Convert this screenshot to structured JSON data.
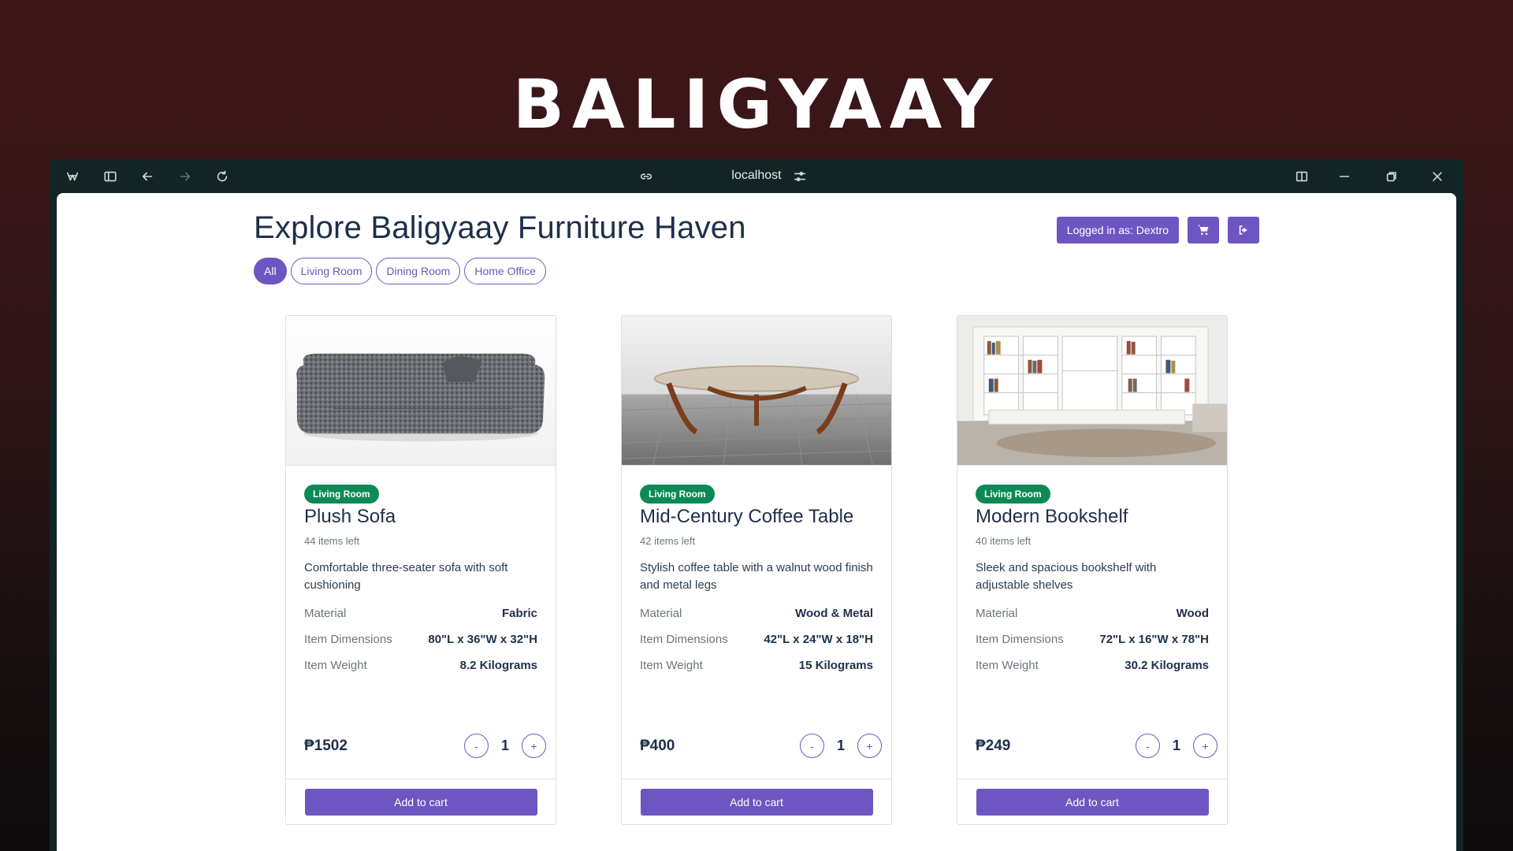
{
  "brand": "BALIGYAAY",
  "browser": {
    "url": "localhost",
    "icons": [
      "app-logo-icon",
      "sidebar-toggle-icon",
      "back-icon",
      "forward-icon",
      "reload-icon",
      "link-icon",
      "site-settings-icon",
      "split-view-icon",
      "minimize-icon",
      "restore-icon",
      "close-icon"
    ]
  },
  "page": {
    "title": "Explore Baligyaay Furniture Haven",
    "logged_in_label": "Logged in as: Dextro",
    "filters": [
      "All",
      "Living Room",
      "Dining Room",
      "Home Office"
    ],
    "active_filter": "All"
  },
  "labels": {
    "material": "Material",
    "dimensions": "Item Dimensions",
    "weight": "Item Weight",
    "minus": "-",
    "plus": "+",
    "add_to_cart": "Add to cart"
  },
  "products": [
    {
      "category": "Living Room",
      "name": "Plush Sofa",
      "stock": "44 items left",
      "description": "Comfortable three-seater sofa with soft cushioning",
      "material": "Fabric",
      "dimensions": "80\"L x 36\"W x 32\"H",
      "weight": "8.2 Kilograms",
      "price": "₱1502",
      "quantity": "1"
    },
    {
      "category": "Living Room",
      "name": "Mid-Century Coffee Table",
      "stock": "42 items left",
      "description": "Stylish coffee table with a walnut wood finish and metal legs",
      "material": "Wood & Metal",
      "dimensions": "42\"L x 24\"W x 18\"H",
      "weight": "15 Kilograms",
      "price": "₱400",
      "quantity": "1"
    },
    {
      "category": "Living Room",
      "name": "Modern Bookshelf",
      "stock": "40 items left",
      "description": "Sleek and spacious bookshelf with adjustable shelves",
      "material": "Wood",
      "dimensions": "72\"L x 16\"W x 78\"H",
      "weight": "30.2 Kilograms",
      "price": "₱249",
      "quantity": "1"
    }
  ],
  "colors": {
    "accent": "#6d56c1",
    "badge": "#0c8a55",
    "heading": "#1e2f4a",
    "window_chrome": "#132424"
  }
}
